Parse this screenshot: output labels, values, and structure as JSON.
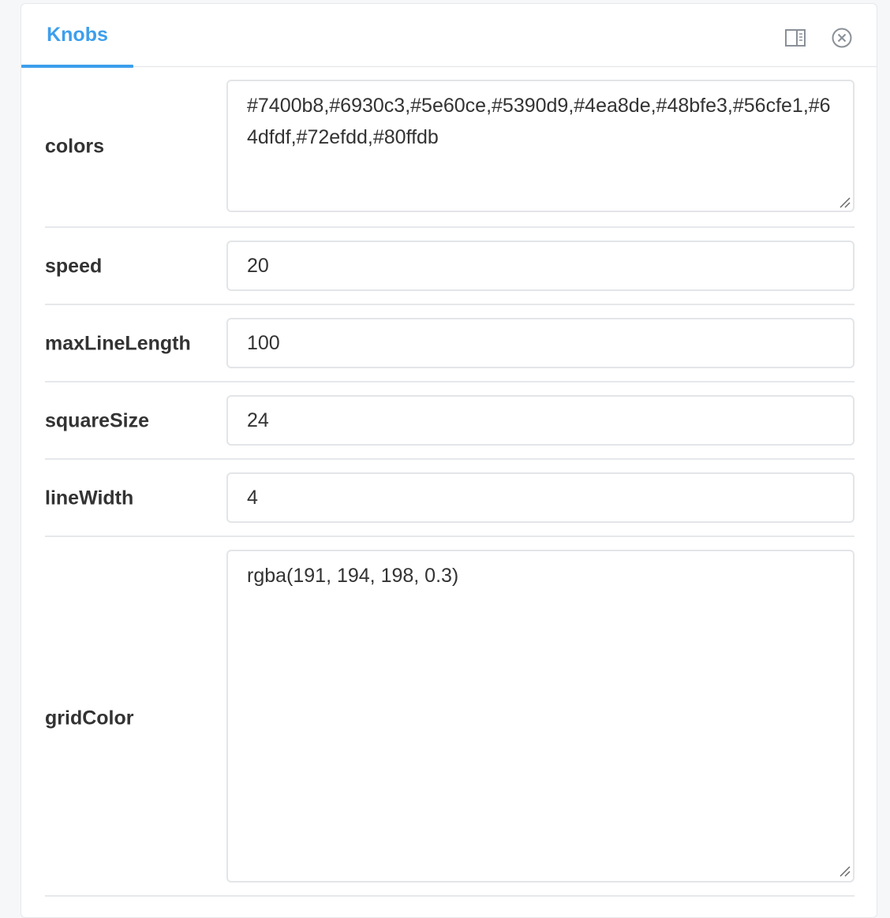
{
  "addon": {
    "tab_label": "Knobs",
    "icons": [
      "panel-layout-icon",
      "close-circle-icon"
    ]
  },
  "knobs": [
    {
      "name": "colors",
      "type": "textarea",
      "value": "#7400b8,#6930c3,#5e60ce,#5390d9,#4ea8de,#48bfe3,#56cfe1,#64dfdf,#72efdd,#80ffdb"
    },
    {
      "name": "speed",
      "type": "number",
      "value": "20"
    },
    {
      "name": "maxLineLength",
      "type": "number",
      "value": "100"
    },
    {
      "name": "squareSize",
      "type": "number",
      "value": "24"
    },
    {
      "name": "lineWidth",
      "type": "number",
      "value": "4"
    },
    {
      "name": "gridColor",
      "type": "textarea",
      "value": "rgba(191, 194, 198, 0.3)"
    }
  ],
  "theme": {
    "accent": "#3d9fec",
    "label_color": "#333333",
    "border_color": "#e3e5e8"
  }
}
